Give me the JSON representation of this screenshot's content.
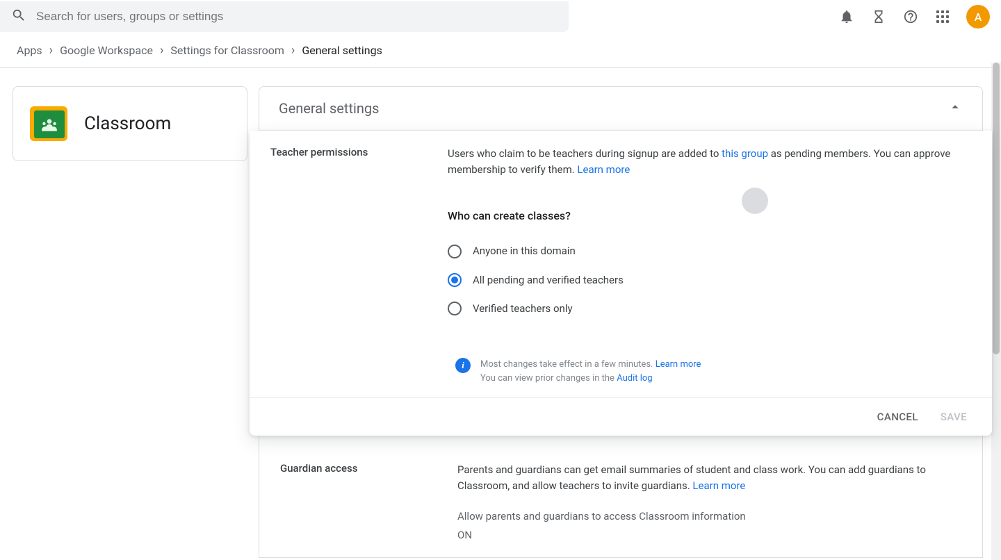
{
  "search": {
    "placeholder": "Search for users, groups or settings"
  },
  "avatar": {
    "initial": "A"
  },
  "breadcrumbs": {
    "items": [
      "Apps",
      "Google Workspace",
      "Settings for Classroom"
    ],
    "current": "General settings"
  },
  "sidecard": {
    "title": "Classroom"
  },
  "panel": {
    "title": "General settings"
  },
  "teacher": {
    "label": "Teacher permissions",
    "desc_before": "Users who claim to be teachers during signup are added to ",
    "desc_link": "this group",
    "desc_after": " as pending members. You can approve membership to verify them. ",
    "learn_more": "Learn more",
    "question": "Who can create classes?",
    "options": [
      "Anyone in this domain",
      "All pending and verified teachers",
      "Verified teachers only"
    ],
    "selected_index": 1
  },
  "info": {
    "line1_before": "Most changes take effect in a few minutes. ",
    "line1_link": "Learn more",
    "line2_before": "You can view prior changes in the ",
    "line2_link": "Audit log"
  },
  "actions": {
    "cancel": "CANCEL",
    "save": "SAVE"
  },
  "guardian": {
    "label": "Guardian access",
    "desc": "Parents and guardians can get email summaries of student and class work. You can add guardians to Classroom, and allow teachers to invite guardians. ",
    "learn_more": "Learn more",
    "sub": "Allow parents and guardians to access Classroom information",
    "value": "ON"
  }
}
